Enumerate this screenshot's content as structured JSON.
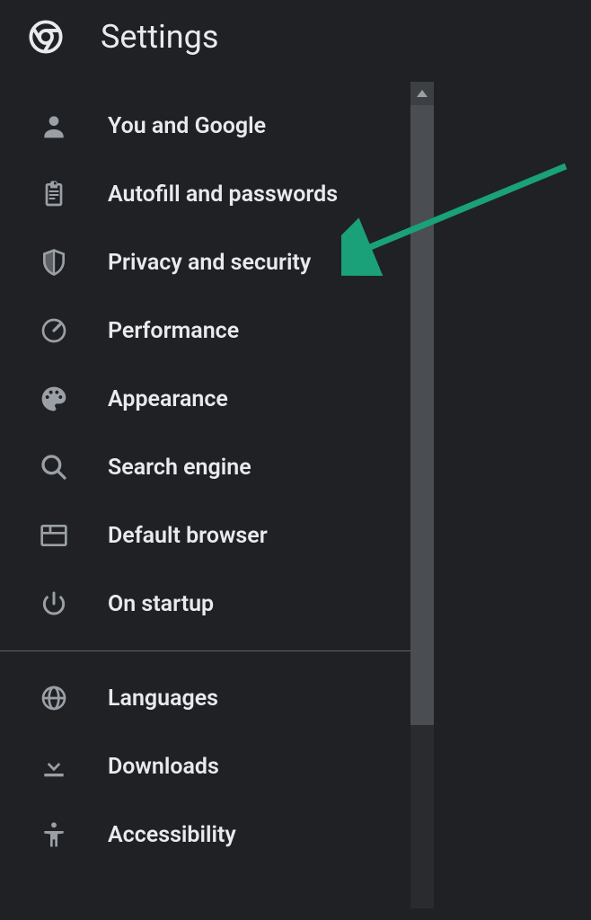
{
  "header": {
    "title": "Settings"
  },
  "sidebar": {
    "items": [
      {
        "label": "You and Google",
        "icon": "person"
      },
      {
        "label": "Autofill and passwords",
        "icon": "clipboard"
      },
      {
        "label": "Privacy and security",
        "icon": "shield"
      },
      {
        "label": "Performance",
        "icon": "speedometer"
      },
      {
        "label": "Appearance",
        "icon": "palette"
      },
      {
        "label": "Search engine",
        "icon": "search"
      },
      {
        "label": "Default browser",
        "icon": "browser"
      },
      {
        "label": "On startup",
        "icon": "power"
      }
    ],
    "items2": [
      {
        "label": "Languages",
        "icon": "globe"
      },
      {
        "label": "Downloads",
        "icon": "download"
      },
      {
        "label": "Accessibility",
        "icon": "accessibility"
      }
    ]
  },
  "annotation": {
    "arrow_color": "#1aa179"
  }
}
